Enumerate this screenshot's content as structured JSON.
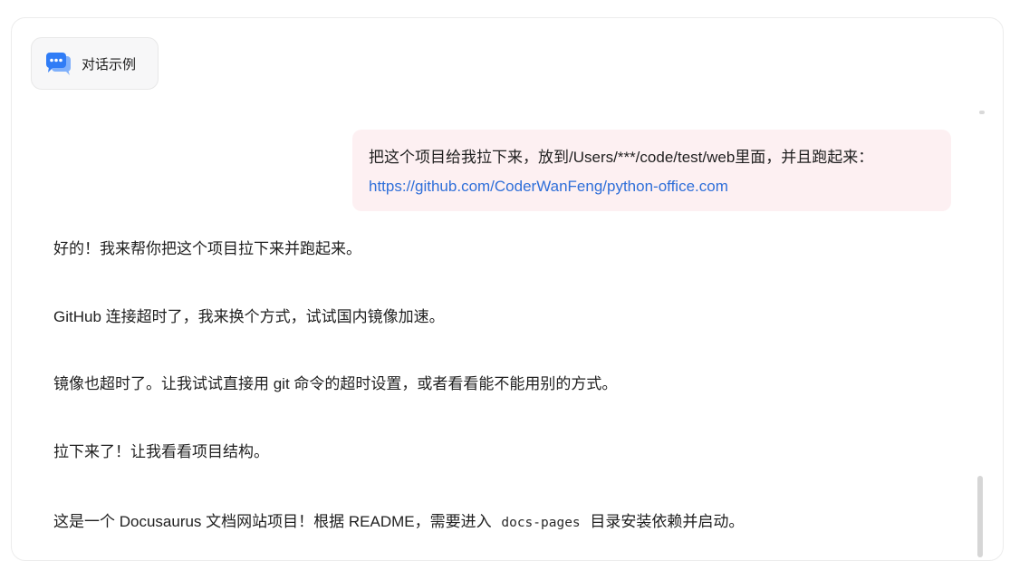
{
  "tab": {
    "label": "对话示例",
    "icon": "chat-bubble-icon",
    "icon_color": "#2f7cf6"
  },
  "user_message": {
    "text": "把这个项目给我拉下来，放到/Users/***/code/test/web里面，并且跑起来：",
    "link": "https://github.com/CoderWanFeng/python-office.com"
  },
  "replies": {
    "r1": "好的！我来帮你把这个项目拉下来并跑起来。",
    "r2": "GitHub 连接超时了，我来换个方式，试试国内镜像加速。",
    "r3": "镜像也超时了。让我试试直接用 git 命令的超时设置，或者看看能不能用别的方式。",
    "r4": "拉下来了！让我看看项目结构。",
    "r5_before": "这是一个 Docusaurus 文档网站项目！根据 README，需要进入",
    "r5_code": "docs-pages",
    "r5_after": "目录安装依赖并启动。"
  },
  "colors": {
    "user_bubble_bg": "#fdf0f2",
    "link": "#2f6fd9",
    "tab_bg": "#f7f7f8"
  }
}
